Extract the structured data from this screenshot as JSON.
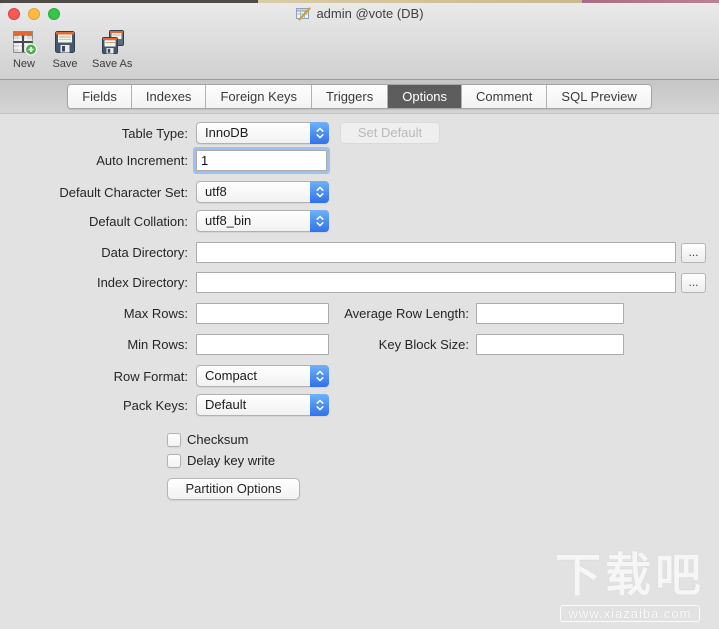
{
  "window": {
    "title": "admin @vote (DB)"
  },
  "toolbar": {
    "items": [
      {
        "label": "New",
        "icon": "new-table-icon"
      },
      {
        "label": "Save",
        "icon": "save-icon"
      },
      {
        "label": "Save As",
        "icon": "save-as-icon"
      }
    ]
  },
  "tabs": {
    "items": [
      {
        "label": "Fields",
        "selected": false
      },
      {
        "label": "Indexes",
        "selected": false
      },
      {
        "label": "Foreign Keys",
        "selected": false
      },
      {
        "label": "Triggers",
        "selected": false
      },
      {
        "label": "Options",
        "selected": true
      },
      {
        "label": "Comment",
        "selected": false
      },
      {
        "label": "SQL Preview",
        "selected": false
      }
    ]
  },
  "form": {
    "table_type": {
      "label": "Table Type:",
      "value": "InnoDB"
    },
    "set_default": {
      "label": "Set Default",
      "enabled": false
    },
    "auto_increment": {
      "label": "Auto Increment:",
      "value": "1"
    },
    "default_charset": {
      "label": "Default Character Set:",
      "value": "utf8"
    },
    "default_collation": {
      "label": "Default Collation:",
      "value": "utf8_bin"
    },
    "data_directory": {
      "label": "Data Directory:",
      "value": "",
      "browse_label": "..."
    },
    "index_directory": {
      "label": "Index Directory:",
      "value": "",
      "browse_label": "..."
    },
    "max_rows": {
      "label": "Max Rows:",
      "value": ""
    },
    "avg_row_length": {
      "label": "Average Row Length:",
      "value": ""
    },
    "min_rows": {
      "label": "Min Rows:",
      "value": ""
    },
    "key_block_size": {
      "label": "Key Block Size:",
      "value": ""
    },
    "row_format": {
      "label": "Row Format:",
      "value": "Compact"
    },
    "pack_keys": {
      "label": "Pack Keys:",
      "value": "Default"
    },
    "checksum": {
      "label": "Checksum",
      "checked": false
    },
    "delay_key_write": {
      "label": "Delay key write",
      "checked": false
    },
    "partition_options": {
      "label": "Partition Options"
    }
  },
  "watermark": {
    "title": "下载吧",
    "url": "www.xiazaiba.com"
  },
  "colors": {
    "popup_blue_top": "#6fb2f9",
    "popup_blue_bottom": "#2e71ec",
    "selected_tab_bg": "#5d5d5d",
    "focus_ring": "#9cc1ec",
    "traffic_red": "#fc5753",
    "traffic_yellow": "#fdbc40",
    "traffic_green": "#33c748",
    "toolbar_icon_orange": "#e06a32"
  }
}
